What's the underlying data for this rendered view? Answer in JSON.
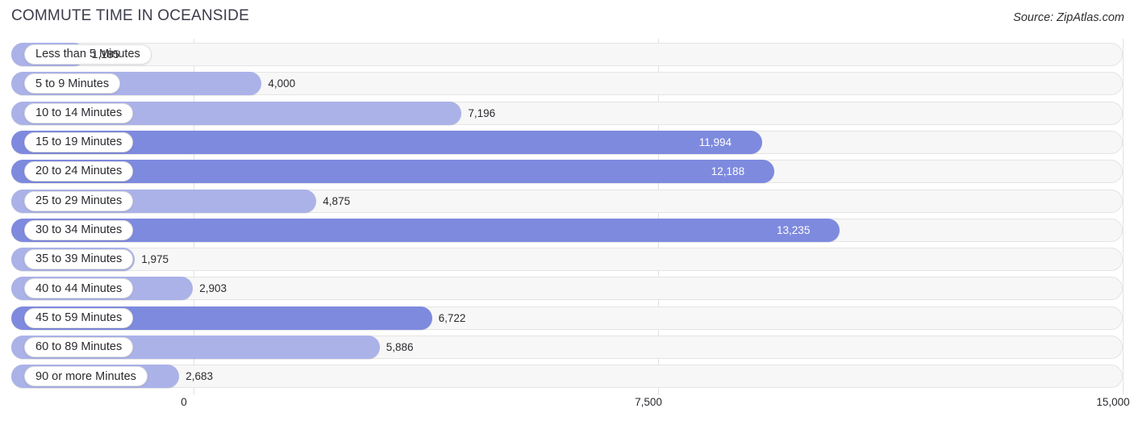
{
  "header": {
    "title": "COMMUTE TIME IN OCEANSIDE",
    "source": "Source: ZipAtlas.com"
  },
  "chart_data": {
    "type": "bar",
    "orientation": "horizontal",
    "title": "COMMUTE TIME IN OCEANSIDE",
    "xlabel": "",
    "ylabel": "",
    "xlim": [
      0,
      15000
    ],
    "grid": true,
    "legend": null,
    "xticks": [
      0,
      7500,
      15000
    ],
    "xtick_labels": [
      "0",
      "7,500",
      "15,000"
    ],
    "categories": [
      "Less than 5 Minutes",
      "5 to 9 Minutes",
      "10 to 14 Minutes",
      "15 to 19 Minutes",
      "20 to 24 Minutes",
      "25 to 29 Minutes",
      "30 to 34 Minutes",
      "35 to 39 Minutes",
      "40 to 44 Minutes",
      "45 to 59 Minutes",
      "60 to 89 Minutes",
      "90 or more Minutes"
    ],
    "values": [
      1185,
      4000,
      7196,
      11994,
      12188,
      4875,
      13235,
      1975,
      2903,
      6722,
      5886,
      2683
    ],
    "value_labels": [
      "1,185",
      "4,000",
      "7,196",
      "11,994",
      "12,188",
      "4,875",
      "13,235",
      "1,975",
      "2,903",
      "6,722",
      "5,886",
      "2,683"
    ],
    "colors": {
      "bar_light": "#aab2e8",
      "bar_strong": "#7e8ade",
      "track": "#f7f7f7",
      "track_border": "#e4e4e4",
      "gridline": "#e2e2e2",
      "label_capsule": "#ffffff",
      "text": "#2b2b30",
      "title_text": "#3b3b4a"
    }
  },
  "rows": [
    {
      "label": "Less than 5 Minutes",
      "value_label": "1,185",
      "value": 1185,
      "strong": false,
      "inside": false
    },
    {
      "label": "5 to 9 Minutes",
      "value_label": "4,000",
      "value": 4000,
      "strong": false,
      "inside": false
    },
    {
      "label": "10 to 14 Minutes",
      "value_label": "7,196",
      "value": 7196,
      "strong": false,
      "inside": false
    },
    {
      "label": "15 to 19 Minutes",
      "value_label": "11,994",
      "value": 11994,
      "strong": true,
      "inside": true
    },
    {
      "label": "20 to 24 Minutes",
      "value_label": "12,188",
      "value": 12188,
      "strong": true,
      "inside": true
    },
    {
      "label": "25 to 29 Minutes",
      "value_label": "4,875",
      "value": 4875,
      "strong": false,
      "inside": false
    },
    {
      "label": "30 to 34 Minutes",
      "value_label": "13,235",
      "value": 13235,
      "strong": true,
      "inside": true
    },
    {
      "label": "35 to 39 Minutes",
      "value_label": "1,975",
      "value": 1975,
      "strong": false,
      "inside": false
    },
    {
      "label": "40 to 44 Minutes",
      "value_label": "2,903",
      "value": 2903,
      "strong": false,
      "inside": false
    },
    {
      "label": "45 to 59 Minutes",
      "value_label": "6,722",
      "value": 6722,
      "strong": true,
      "inside": false
    },
    {
      "label": "60 to 89 Minutes",
      "value_label": "5,886",
      "value": 5886,
      "strong": false,
      "inside": false
    },
    {
      "label": "90 or more Minutes",
      "value_label": "2,683",
      "value": 2683,
      "strong": false,
      "inside": false
    }
  ],
  "axis": {
    "ticks": [
      {
        "label": "0",
        "value": 0
      },
      {
        "label": "7,500",
        "value": 7500
      },
      {
        "label": "15,000",
        "value": 15000
      }
    ]
  }
}
